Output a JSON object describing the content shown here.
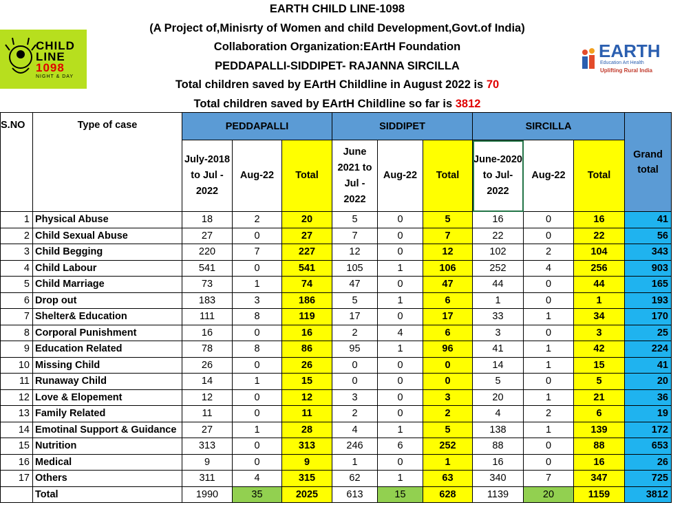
{
  "header": {
    "title": "EARTH CHILD LINE-1098",
    "project": "(A Project of,Minisrty of Women and child Development,Govt.of India)",
    "collab": "Collaboration Organization:EArtH Foundation",
    "districts": "PEDDAPALLI-SIDDIPET- RAJANNA SIRCILLA",
    "aug_prefix": "Total children saved by EArtH Childline in August 2022 is ",
    "aug_value": "70",
    "sofar_prefix": "Total children saved by EArtH Childline so far is ",
    "sofar_value": "3812"
  },
  "logos": {
    "childline_top": "CHILD",
    "childline_mid": "LINE",
    "childline_num": "1098",
    "childline_tag": "NIGHT & DAY",
    "earth_name": "EARTH",
    "earth_sub": "Education Art Health",
    "earth_tag": "Uplifting Rural India"
  },
  "colors": {
    "blue_header": "#5b9bd5",
    "yellow": "#ffff00",
    "cyan": "#1fb3ef",
    "green": "#92d050",
    "red": "#e00000"
  },
  "table": {
    "col_sno": "S.NO",
    "col_type": "Type of case",
    "groups": [
      "PEDDAPALLI",
      "SIDDIPET",
      "SIRCILLA"
    ],
    "grand_total": "Grand total",
    "sub": {
      "p_period": "July-2018 to Jul - 2022",
      "s_period": "June 2021 to Jul - 2022",
      "c_period": "June-2020 to Jul-2022",
      "aug": "Aug-22",
      "total": "Total"
    },
    "rows": [
      {
        "sno": "1",
        "type": "Physical Abuse",
        "p": [
          "18",
          "2",
          "20"
        ],
        "s": [
          "5",
          "0",
          "5"
        ],
        "c": [
          "16",
          "0",
          "16"
        ],
        "g": "41"
      },
      {
        "sno": "2",
        "type": "Child Sexual Abuse",
        "p": [
          "27",
          "0",
          "27"
        ],
        "s": [
          "7",
          "0",
          "7"
        ],
        "c": [
          "22",
          "0",
          "22"
        ],
        "g": "56"
      },
      {
        "sno": "3",
        "type": "Child Begging",
        "p": [
          "220",
          "7",
          "227"
        ],
        "s": [
          "12",
          "0",
          "12"
        ],
        "c": [
          "102",
          "2",
          "104"
        ],
        "g": "343"
      },
      {
        "sno": "4",
        "type": "Child Labour",
        "p": [
          "541",
          "0",
          "541"
        ],
        "s": [
          "105",
          "1",
          "106"
        ],
        "c": [
          "252",
          "4",
          "256"
        ],
        "g": "903"
      },
      {
        "sno": "5",
        "type": "Child Marriage",
        "p": [
          "73",
          "1",
          "74"
        ],
        "s": [
          "47",
          "0",
          "47"
        ],
        "c": [
          "44",
          "0",
          "44"
        ],
        "g": "165"
      },
      {
        "sno": "6",
        "type": "Drop out",
        "p": [
          "183",
          "3",
          "186"
        ],
        "s": [
          "5",
          "1",
          "6"
        ],
        "c": [
          "1",
          "0",
          "1"
        ],
        "g": "193"
      },
      {
        "sno": "7",
        "type": "Shelter& Education",
        "p": [
          "111",
          "8",
          "119"
        ],
        "s": [
          "17",
          "0",
          "17"
        ],
        "c": [
          "33",
          "1",
          "34"
        ],
        "g": "170"
      },
      {
        "sno": "8",
        "type": "Corporal Punishment",
        "p": [
          "16",
          "0",
          "16"
        ],
        "s": [
          "2",
          "4",
          "6"
        ],
        "c": [
          "3",
          "0",
          "3"
        ],
        "g": "25"
      },
      {
        "sno": "9",
        "type": "Education Related",
        "p": [
          "78",
          "8",
          "86"
        ],
        "s": [
          "95",
          "1",
          "96"
        ],
        "c": [
          "41",
          "1",
          "42"
        ],
        "g": "224"
      },
      {
        "sno": "10",
        "type": "Missing Child",
        "p": [
          "26",
          "0",
          "26"
        ],
        "s": [
          "0",
          "0",
          "0"
        ],
        "c": [
          "14",
          "1",
          "15"
        ],
        "g": "41"
      },
      {
        "sno": "11",
        "type": "Runaway Child",
        "p": [
          "14",
          "1",
          "15"
        ],
        "s": [
          "0",
          "0",
          "0"
        ],
        "c": [
          "5",
          "0",
          "5"
        ],
        "g": "20"
      },
      {
        "sno": "12",
        "type": "Love & Elopement",
        "p": [
          "12",
          "0",
          "12"
        ],
        "s": [
          "3",
          "0",
          "3"
        ],
        "c": [
          "20",
          "1",
          "21"
        ],
        "g": "36"
      },
      {
        "sno": "13",
        "type": "Family Related",
        "p": [
          "11",
          "0",
          "11"
        ],
        "s": [
          "2",
          "0",
          "2"
        ],
        "c": [
          "4",
          "2",
          "6"
        ],
        "g": "19"
      },
      {
        "sno": "14",
        "type": "Emotinal Support & Guidance",
        "p": [
          "27",
          "1",
          "28"
        ],
        "s": [
          "4",
          "1",
          "5"
        ],
        "c": [
          "138",
          "1",
          "139"
        ],
        "g": "172"
      },
      {
        "sno": "15",
        "type": "Nutrition",
        "p": [
          "313",
          "0",
          "313"
        ],
        "s": [
          "246",
          "6",
          "252"
        ],
        "c": [
          "88",
          "0",
          "88"
        ],
        "g": "653"
      },
      {
        "sno": "16",
        "type": "Medical",
        "p": [
          "9",
          "0",
          "9"
        ],
        "s": [
          "1",
          "0",
          "1"
        ],
        "c": [
          "16",
          "0",
          "16"
        ],
        "g": "26"
      },
      {
        "sno": "17",
        "type": " Others",
        "p": [
          "311",
          "4",
          "315"
        ],
        "s": [
          "62",
          "1",
          "63"
        ],
        "c": [
          "340",
          "7",
          "347"
        ],
        "g": "725"
      }
    ],
    "total_row": {
      "label": "Total",
      "p": [
        "1990",
        "35",
        "2025"
      ],
      "s": [
        "613",
        "15",
        "628"
      ],
      "c": [
        "1139",
        "20",
        "1159"
      ],
      "g": "3812"
    }
  }
}
